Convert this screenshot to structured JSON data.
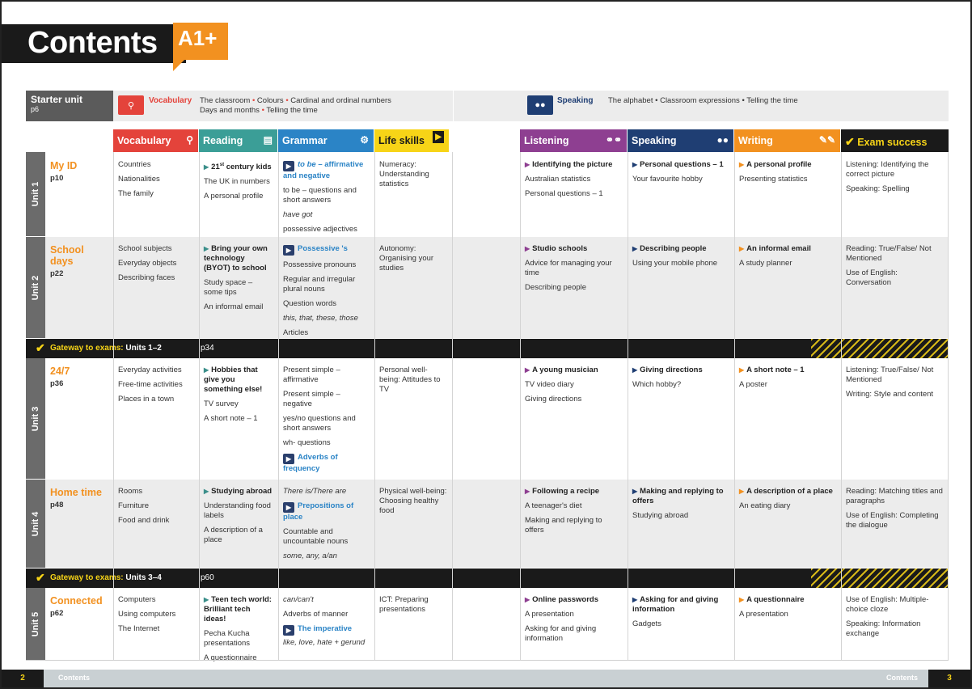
{
  "header": {
    "title": "Contents",
    "level": "A1+"
  },
  "starter": {
    "label": "Starter unit",
    "page": "p6",
    "vocab_kw": "Vocabulary",
    "vocab_line1": [
      "The classroom",
      "Colours",
      "Cardinal and ordinal numbers"
    ],
    "vocab_line2": [
      "Days and months",
      "Telling the time"
    ],
    "speak_kw": "Speaking",
    "speak_line": [
      "The alphabet",
      "Classroom expressions",
      "Telling the time"
    ]
  },
  "columns": {
    "vocabulary": "Vocabulary",
    "reading": "Reading",
    "grammar": "Grammar",
    "life_skills": "Life skills",
    "listening": "Listening",
    "speaking": "Speaking",
    "writing": "Writing",
    "exam": "Exam success"
  },
  "colors": {
    "vocabulary": "#e4433b",
    "reading": "#3b9e97",
    "grammar": "#2b84c6",
    "life_skills": "#f7d417",
    "listening": "#8e3f91",
    "speaking": "#1f3e73",
    "writing": "#f29120",
    "exam": "#1a1a1a"
  },
  "units": [
    {
      "side": "Unit 1",
      "title": "My ID",
      "page": "p10",
      "vocabulary": [
        "Countries",
        "Nationalities",
        "The family"
      ],
      "reading": {
        "head_a": "21",
        "head_sup": "st",
        "head_b": " century kids",
        "items": [
          "The UK in numbers",
          "A personal profile"
        ]
      },
      "grammar": {
        "video": "to be",
        "video_rest": " – affirmative and negative",
        "items": [
          "to be – questions and short answers",
          "have got",
          "possessive adjectives"
        ]
      },
      "life": "Numeracy: Understanding statistics",
      "listening": {
        "head": "Identifying the picture",
        "items": [
          "Australian statistics",
          "Personal questions – 1"
        ]
      },
      "speaking": {
        "head": "Personal questions – 1",
        "items": [
          "Your favourite hobby"
        ]
      },
      "writing": {
        "head": "A personal profile",
        "items": [
          "Presenting statistics"
        ]
      },
      "exam": [
        "Listening: Identifying the correct picture",
        "Speaking: Spelling"
      ]
    },
    {
      "side": "Unit 2",
      "title": "School days",
      "page": "p22",
      "vocabulary": [
        "School subjects",
        "Everyday objects",
        "Describing faces"
      ],
      "reading": {
        "head": "Bring your own technology (BYOT) to school",
        "items": [
          "Study space – some tips",
          "An informal email"
        ]
      },
      "grammar": {
        "video": "Possessive 's",
        "items": [
          "Possessive pronouns",
          "Regular and irregular plural nouns",
          "Question words",
          "this, that, these, those",
          "Articles"
        ]
      },
      "life": "Autonomy: Organising your studies",
      "listening": {
        "head": "Studio schools",
        "items": [
          "Advice for managing your time",
          "Describing people"
        ]
      },
      "speaking": {
        "head": "Describing people",
        "items": [
          "Using your mobile phone"
        ]
      },
      "writing": {
        "head": "An informal email",
        "items": [
          "A study planner"
        ]
      },
      "exam": [
        "Reading: True/False/ Not Mentioned",
        "Use of English: Conversation"
      ]
    },
    {
      "side": "Unit 3",
      "title": "24/7",
      "page": "p36",
      "vocabulary": [
        "Everyday activities",
        "Free-time activities",
        "Places in a town"
      ],
      "reading": {
        "head": "Hobbies that give you something else!",
        "items": [
          "TV survey",
          "A short note – 1"
        ]
      },
      "grammar": {
        "items": [
          "Present simple – affirmative",
          "Present simple – negative",
          "yes/no questions and short answers",
          "wh- questions"
        ],
        "video": "Adverbs of frequency"
      },
      "life": "Personal well-being: Attitudes to TV",
      "listening": {
        "head": "A young musician",
        "items": [
          "TV video diary",
          "Giving directions"
        ]
      },
      "speaking": {
        "head": "Giving directions",
        "items": [
          "Which hobby?"
        ]
      },
      "writing": {
        "head": "A short note – 1",
        "items": [
          "A poster"
        ]
      },
      "exam": [
        "Listening: True/False/ Not Mentioned",
        "Writing: Style and content"
      ]
    },
    {
      "side": "Unit 4",
      "title": "Home time",
      "page": "p48",
      "vocabulary": [
        "Rooms",
        "Furniture",
        "Food and drink"
      ],
      "reading": {
        "head": "Studying abroad",
        "items": [
          "Understanding food labels",
          "A description of a place"
        ]
      },
      "grammar": {
        "pre": "There is/There are",
        "video": "Prepositions of place",
        "items": [
          "Countable and uncountable nouns",
          "some, any, a/an"
        ]
      },
      "life": "Physical well-being: Choosing healthy food",
      "listening": {
        "head": "Following a recipe",
        "items": [
          "A teenager's diet",
          "Making and replying to offers"
        ]
      },
      "speaking": {
        "head": "Making and replying to offers",
        "items": [
          "Studying abroad"
        ]
      },
      "writing": {
        "head": "A description of a place",
        "items": [
          "An eating diary"
        ]
      },
      "exam": [
        "Reading: Matching titles and paragraphs",
        "Use of English: Completing the dialogue"
      ]
    },
    {
      "side": "Unit 5",
      "title": "Connected",
      "page": "p62",
      "vocabulary": [
        "Computers",
        "Using computers",
        "The Internet"
      ],
      "reading": {
        "head": "Teen tech world: Brilliant tech ideas!",
        "items": [
          "Pecha Kucha presentations",
          "A questionnaire"
        ]
      },
      "grammar": {
        "pre": "can/can't",
        "pre2": "Adverbs of manner",
        "video": "The imperative",
        "post": "like, love, hate + gerund"
      },
      "life": "ICT: Preparing presentations",
      "listening": {
        "head": "Online passwords",
        "items": [
          "A presentation",
          "Asking for and giving information"
        ]
      },
      "speaking": {
        "head": "Asking for and giving information",
        "items": [
          "Gadgets"
        ]
      },
      "writing": {
        "head": "A questionnaire",
        "items": [
          "A presentation"
        ]
      },
      "exam": [
        "Use of English: Multiple-choice cloze",
        "Speaking: Information exchange"
      ]
    }
  ],
  "gateways": [
    {
      "label": "Gateway to exams:",
      "units": "Units 1–2",
      "page": "p34"
    },
    {
      "label": "Gateway to exams:",
      "units": "Units 3–4",
      "page": "p60"
    }
  ],
  "footer": {
    "left_num": "2",
    "left_text": "Contents",
    "right_text": "Contents",
    "right_num": "3"
  }
}
